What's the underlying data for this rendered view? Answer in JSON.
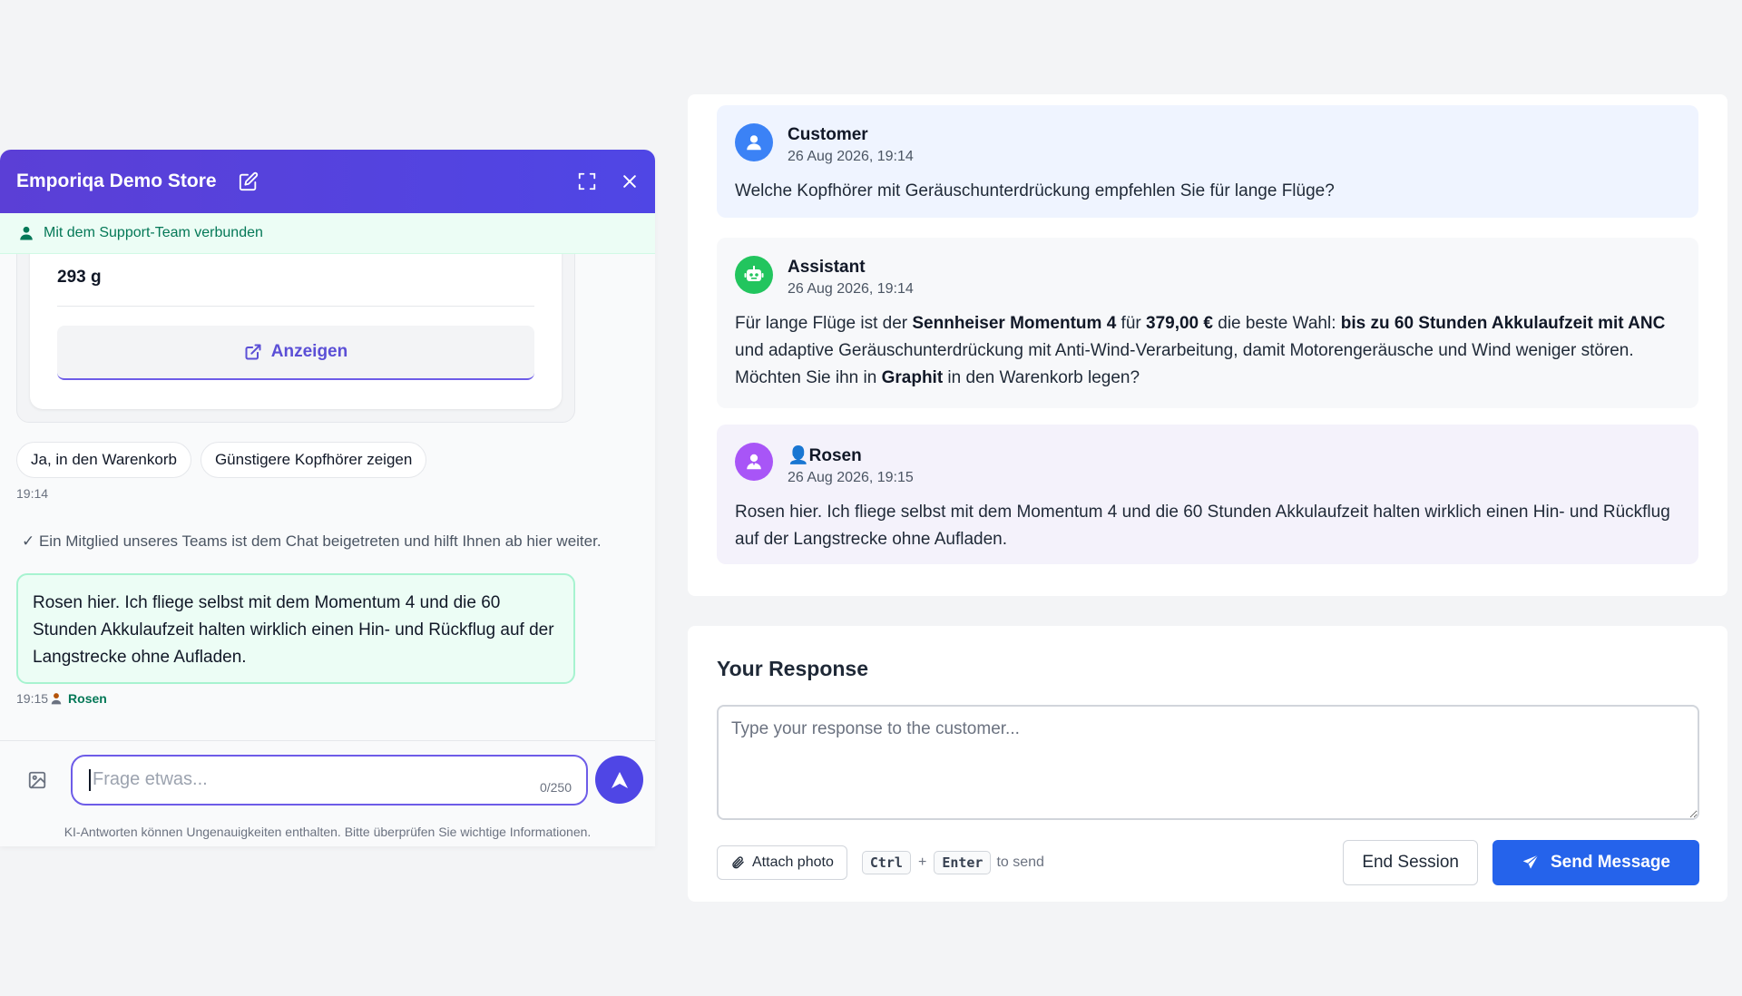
{
  "widget": {
    "title": "Emporiqa Demo Store",
    "status": "Mit dem Support-Team verbunden",
    "product": {
      "weight": "293 g",
      "view_label": "Anzeigen"
    },
    "chips": [
      "Ja, in den Warenkorb",
      "Günstigere Kopfhörer zeigen"
    ],
    "time_assistant": "19:14",
    "system_message": "✓ Ein Mitglied unseres Teams ist dem Chat beigetreten und hilft Ihnen ab hier weiter.",
    "agent_message": "Rosen hier. Ich fliege selbst mit dem Momentum 4 und die 60 Stunden Akkulaufzeit halten wirklich einen Hin- und Rückflug auf der Langstrecke ohne Aufladen.",
    "agent_time": "19:15",
    "agent_name": "Rosen",
    "input_placeholder": "Frage etwas...",
    "char_count": "0/250",
    "disclaimer": "KI-Antworten können Ungenauigkeiten enthalten. Bitte überprüfen Sie wichtige Informationen.",
    "colors": {
      "header": "#4f46e5",
      "status_bg": "#ecfdf5",
      "agent_bubble": "#ecfdf5"
    }
  },
  "conversation": {
    "messages": [
      {
        "role": "Customer",
        "time": "26 Aug 2026, 19:14",
        "text": "Welche Kopfhörer mit Geräuschunterdrückung empfehlen Sie für lange Flüge?",
        "icon": "user-icon"
      },
      {
        "role": "Assistant",
        "time": "26 Aug 2026, 19:14",
        "parts": [
          "Für lange Flüge ist der ",
          "Sennheiser Momentum 4",
          " für ",
          "379,00 €",
          " die beste Wahl: ",
          "bis zu 60 Stunden Akkulaufzeit mit ANC",
          " und adaptive Geräuschunterdrückung mit Anti-Wind-Verarbeitung, damit Motorengeräusche und Wind weniger stören. Möchten Sie ihn in ",
          "Graphit",
          " in den Warenkorb legen?"
        ],
        "icon": "robot-icon"
      },
      {
        "role": "👤Rosen",
        "time": "26 Aug 2026, 19:15",
        "text": "Rosen hier. Ich fliege selbst mit dem Momentum 4 und die 60 Stunden Akkulaufzeit halten wirklich einen Hin- und Rückflug auf der Langstrecke ohne Aufladen.",
        "icon": "agent-icon"
      }
    ]
  },
  "response": {
    "title": "Your Response",
    "placeholder": "Type your response to the customer...",
    "attach_label": "Attach photo",
    "kbd_ctrl": "Ctrl",
    "kbd_plus": "+",
    "kbd_enter": "Enter",
    "kbd_tail": "to send",
    "end_label": "End Session",
    "send_label": "Send Message",
    "colors": {
      "send": "#2563eb"
    }
  }
}
